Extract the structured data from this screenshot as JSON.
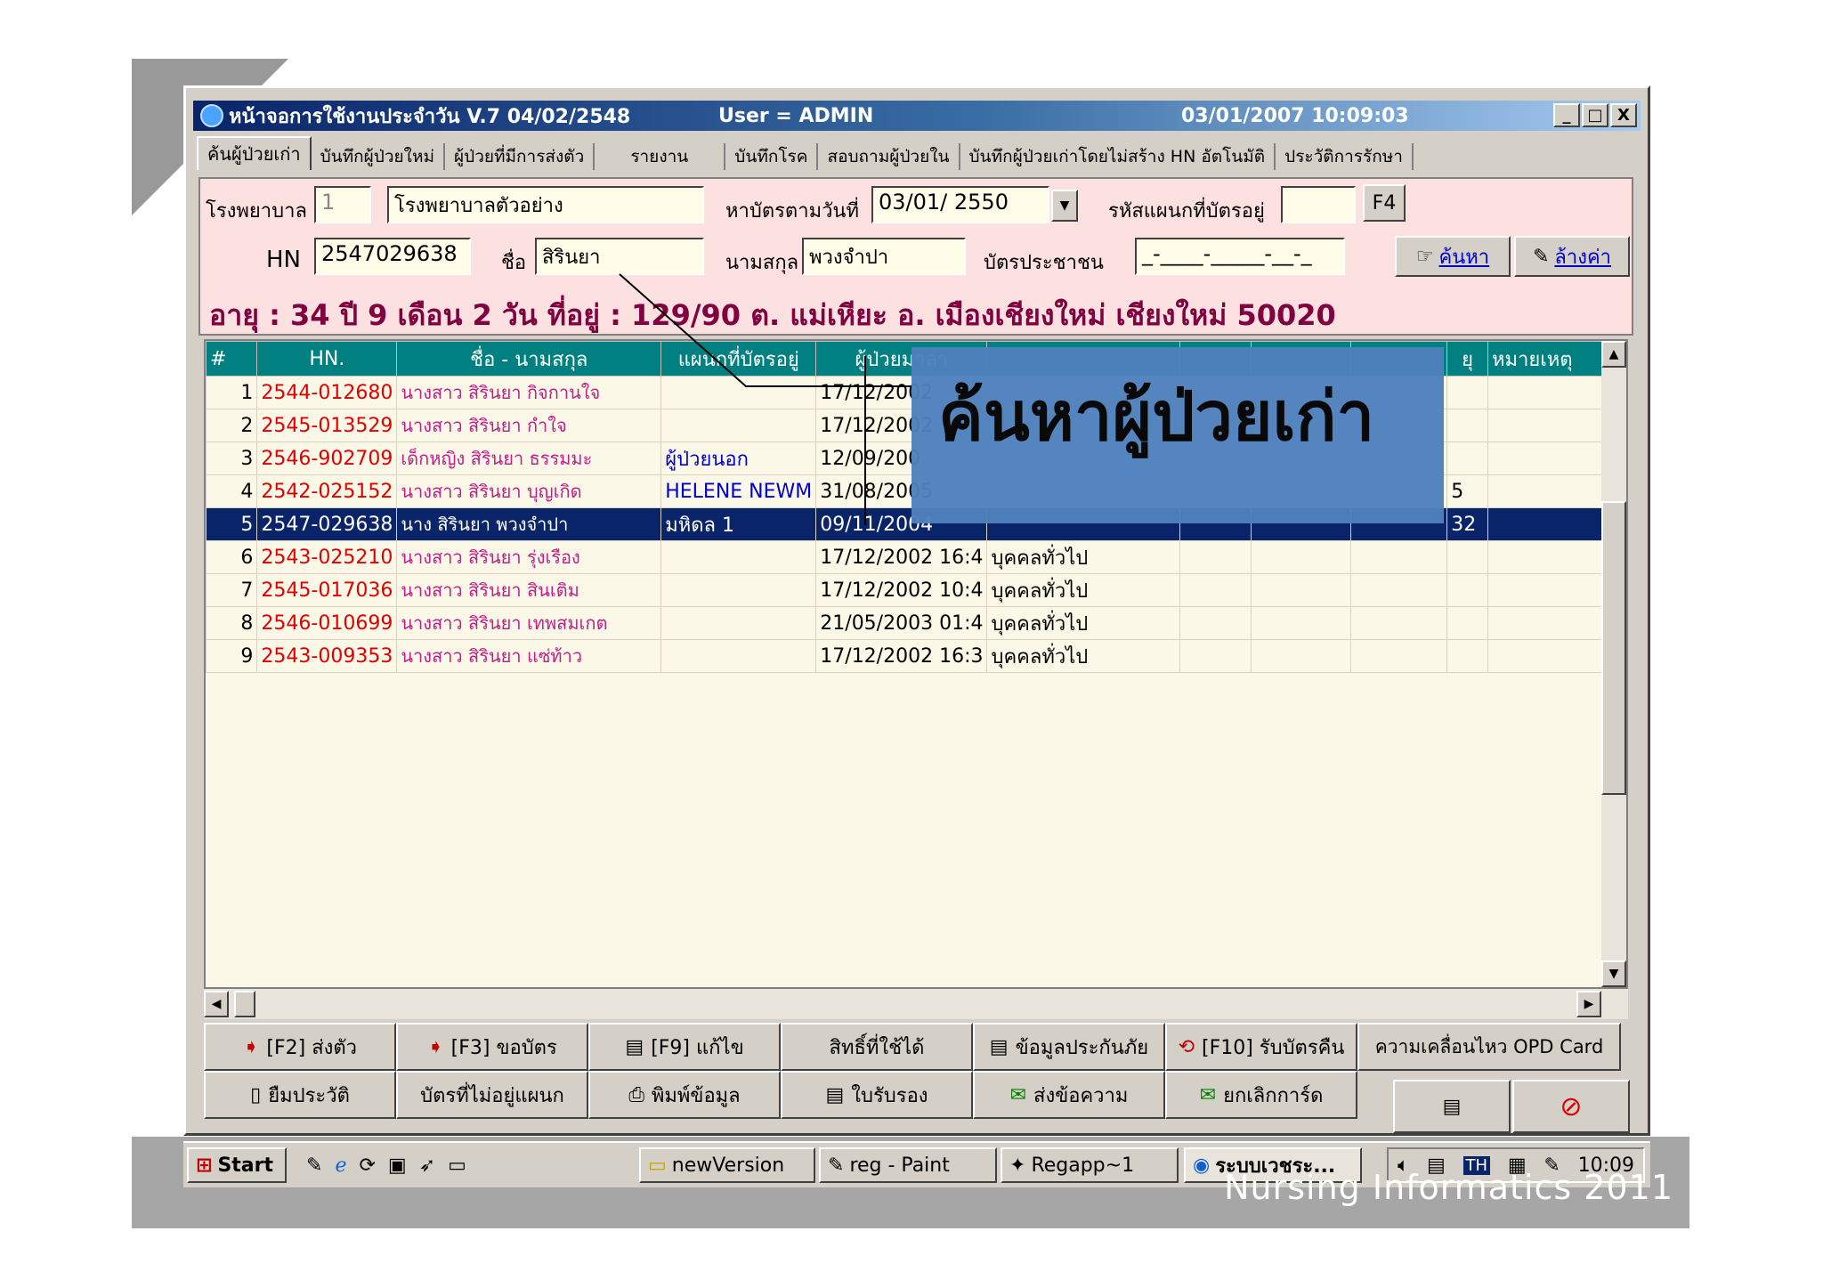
{
  "footer": "Nursing Informatics 2011",
  "overlay_label": "ค้นหาผู้ป่วยเก่า",
  "window": {
    "title_left": "หน้าจอการใช้งานประจำวัน V.7 04/02/2548",
    "title_user": "User  =  ADMIN",
    "title_datetime": "03/01/2007 10:09:03",
    "btn_min": "_",
    "btn_max": "□",
    "btn_close": "X"
  },
  "tabs": [
    "ค้นผู้ป่วยเก่า",
    "บันทึกผู้ป่วยใหม่",
    "ผู้ป่วยที่มีการส่งตัว",
    "รายงาน",
    "บันทึกโรค",
    "สอบถามผู้ป่วยใน",
    "บันทึกผู้ป่วยเก่าโดยไม่สร้าง HN อัตโนมัติ",
    "ประวัติการรักษา"
  ],
  "form": {
    "hospital_label": "โรงพยาบาล",
    "hospital_code": "1",
    "hospital_name": "โรงพยาบาลตัวอย่าง",
    "card_date_label": "หาบัตรตามวันที่",
    "card_date": "03/01/ 2550",
    "dept_code_label": "รหัสแผนกที่บัตรอยู่",
    "dept_code": "",
    "f4": "F4",
    "hn_label": "HN",
    "hn": "2547029638",
    "name_label": "ชื่อ",
    "name": "สิรินยา",
    "surname_label": "นามสกุล",
    "surname": "พวงจำปา",
    "idcard_label": "บัตรประชาชน",
    "idcard": "_-____-_____-__-_",
    "search_btn": "ค้นหา",
    "clear_btn": "ล้างค่า",
    "age_line": "อายุ : 34  ปี 9  เดือน 2 วัน    ที่อยู่ : 129/90  ต. แม่เหียะ  อ. เมืองเชียงใหม่  เชียงใหม่  50020"
  },
  "grid": {
    "headers": [
      "#",
      "HN.",
      "ชื่อ    -    นามสกุล",
      "แผนกที่บัตรอยู่",
      "ผู้ป่วยมาล่า",
      "",
      "",
      "",
      "",
      "ยุ",
      "หมายเหตุ"
    ],
    "rows": [
      {
        "n": "1",
        "hn": "2544-012680",
        "name": "นางสาว   สิรินยา    กิจกานใจ",
        "clinic": "",
        "date": "17/12/2002",
        "type": "",
        "e": "",
        "f": "",
        "g": "",
        "age": "",
        "note": ""
      },
      {
        "n": "2",
        "hn": "2545-013529",
        "name": "นางสาว   สิรินยา    กำใจ",
        "clinic": "",
        "date": "17/12/2002",
        "type": "",
        "e": "",
        "f": "",
        "g": "",
        "age": "",
        "note": ""
      },
      {
        "n": "3",
        "hn": "2546-902709",
        "name": "เด็กหญิง   สิรินยา    ธรรมมะ",
        "clinic": "ผู้ป่วยนอก",
        "date": "12/09/200",
        "type": "",
        "e": "",
        "f": "",
        "g": "",
        "age": "",
        "note": ""
      },
      {
        "n": "4",
        "hn": "2542-025152",
        "name": "นางสาว   สิรินยา    บุญเกิด",
        "clinic": "HELENE  NEWM",
        "date": "31/08/2005",
        "type": "",
        "e": "",
        "f": "",
        "g": "",
        "age": "5",
        "note": ""
      },
      {
        "n": "5",
        "hn": "2547-029638",
        "name": "นาง   สิรินยา    พวงจำปา",
        "clinic": "มหิดล 1",
        "date": "09/11/2004",
        "type": "",
        "e": "",
        "f": "",
        "g": "",
        "age": "32",
        "note": "",
        "selected": true
      },
      {
        "n": "6",
        "hn": "2543-025210",
        "name": "นางสาว   สิรินยา    รุ่งเรือง",
        "clinic": "",
        "date": "17/12/2002 16:4",
        "type": "บุคคลทั่วไป",
        "e": "",
        "f": "",
        "g": "",
        "age": "",
        "note": ""
      },
      {
        "n": "7",
        "hn": "2545-017036",
        "name": "นางสาว   สิรินยา    สินเติม",
        "clinic": "",
        "date": "17/12/2002 10:4",
        "type": "บุคคลทั่วไป",
        "e": "",
        "f": "",
        "g": "",
        "age": "",
        "note": ""
      },
      {
        "n": "8",
        "hn": "2546-010699",
        "name": "นางสาว   สิรินยา    เทพสมเกต",
        "clinic": "",
        "date": "21/05/2003 01:4",
        "type": "บุคคลทั่วไป",
        "e": "",
        "f": "",
        "g": "",
        "age": "",
        "note": ""
      },
      {
        "n": "9",
        "hn": "2543-009353",
        "name": "นางสาว   สิรินยา    แซ่ท้าว",
        "clinic": "",
        "date": "17/12/2002 16:3",
        "type": "บุคคลทั่วไป",
        "e": "",
        "f": "",
        "g": "",
        "age": "",
        "note": ""
      }
    ]
  },
  "actions": {
    "r1": [
      "[F2] ส่งตัว",
      "[F3] ขอบัตร",
      "[F9] แก้ไข",
      "สิทธิ์ที่ใช้ได้",
      "ข้อมูลประกันภัย",
      "[F10] รับบัตรคืน",
      "ความเคลื่อนไหว OPD Card"
    ],
    "r2": [
      "ยืมประวัติ",
      "บัตรที่ไม่อยู่แผนก",
      "พิมพ์ข้อมูล",
      "ใบรับรอง",
      "ส่งข้อความ",
      "ยกเลิกการ์ด"
    ]
  },
  "taskbar": {
    "start": "Start",
    "items": [
      "newVersion",
      "reg - Paint",
      "Regapp~1",
      "ระบบเวชระ..."
    ],
    "lang": "TH",
    "clock": "10:09"
  },
  "colors": {
    "selected_row": "#0a246a",
    "header": "#008080",
    "panel": "#fde0e0",
    "overlay": "#4f81bd"
  }
}
